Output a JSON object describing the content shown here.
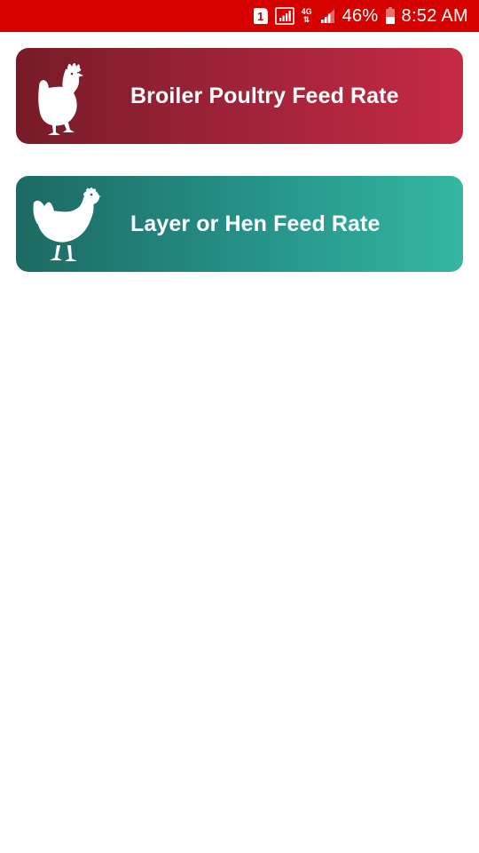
{
  "status_bar": {
    "sim_label": "1",
    "network_type": "4G",
    "battery_percent": "46%",
    "battery_level": 0.46,
    "time": "8:52 AM",
    "background_color": "#d50000"
  },
  "menu": {
    "items": [
      {
        "label": "Broiler Poultry Feed Rate",
        "icon": "rooster-icon",
        "gradient_start": "#771b27",
        "gradient_end": "#c62a44"
      },
      {
        "label": "Layer or Hen Feed Rate",
        "icon": "hen-icon",
        "gradient_start": "#1c6a63",
        "gradient_end": "#34b7a2"
      }
    ]
  }
}
